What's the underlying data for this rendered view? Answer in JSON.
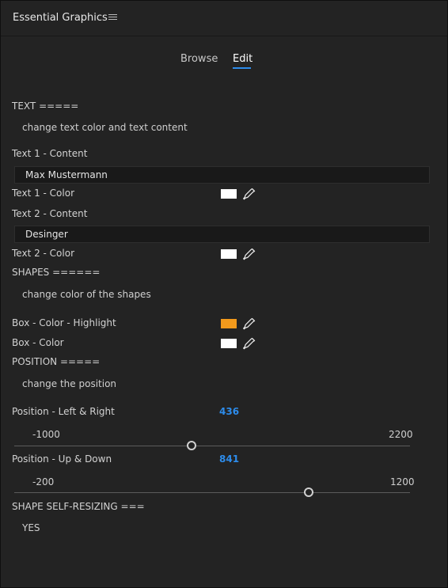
{
  "panel": {
    "title": "Essential Graphics",
    "menu_icon": "hamburger-menu-icon"
  },
  "tabs": [
    {
      "label": "Browse",
      "active": false
    },
    {
      "label": "Edit",
      "active": true
    }
  ],
  "colors": {
    "accent": "#2d8ceb",
    "white_swatch": "#ffffff",
    "highlight_swatch": "#f29a1c"
  },
  "sections": {
    "text": {
      "header": "TEXT =====",
      "description": "change text color and text content",
      "text1_content_label": "Text 1 - Content",
      "text1_content_value": "Max Mustermann",
      "text1_color_label": "Text 1 - Color",
      "text2_content_label": "Text 2 - Content",
      "text2_content_value": "Desinger",
      "text2_color_label": "Text 2 - Color"
    },
    "shapes": {
      "header": "SHAPES ======",
      "description": "change color of the shapes",
      "box_highlight_label": "Box - Color - Highlight",
      "box_color_label": "Box - Color"
    },
    "position": {
      "header": "POSITION =====",
      "description": "change the position",
      "left_right": {
        "label": "Position - Left & Right",
        "value": "436",
        "min": "-1000",
        "max": "2200",
        "numeric_value": 436,
        "numeric_min": -1000,
        "numeric_max": 2200
      },
      "up_down": {
        "label": "Position - Up & Down",
        "value": "841",
        "min": "-200",
        "max": "1200",
        "numeric_value": 841,
        "numeric_min": -200,
        "numeric_max": 1200
      }
    },
    "resizing": {
      "header": "SHAPE SELF-RESIZING ===",
      "value": "YES"
    }
  }
}
